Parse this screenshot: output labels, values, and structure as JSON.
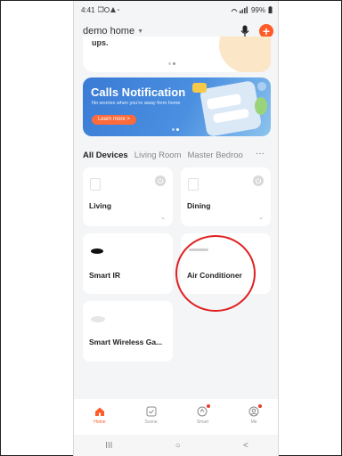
{
  "status_bar": {
    "time": "4:41",
    "battery": "99%"
  },
  "header": {
    "home_name": "demo home"
  },
  "promo_top": {
    "text": "ups."
  },
  "banner": {
    "title": "Calls Notification",
    "subtitle": "No worries when you're away from home",
    "cta": "Learn more >"
  },
  "tabs": [
    "All Devices",
    "Living Room",
    "Master Bedroo",
    "···"
  ],
  "devices": [
    {
      "name": "Living"
    },
    {
      "name": "Dining"
    },
    {
      "name": "Smart IR"
    },
    {
      "name": "Air Conditioner"
    },
    {
      "name": "Smart Wireless Ga..."
    }
  ],
  "bottom_nav": [
    {
      "label": "Home"
    },
    {
      "label": "Scene"
    },
    {
      "label": "Smart"
    },
    {
      "label": "Me"
    }
  ],
  "system_nav": {
    "recents": "III",
    "home": "○",
    "back": "<"
  },
  "colors": {
    "accent": "#ff5a28",
    "banner_blue": "#3a7bd5",
    "annotation": "#e02020"
  }
}
